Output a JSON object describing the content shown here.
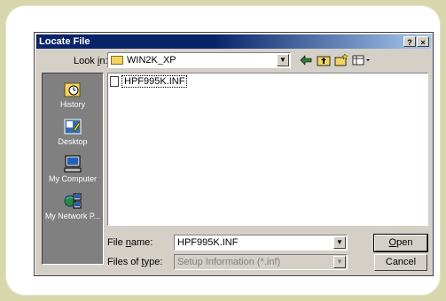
{
  "dialog": {
    "title": "Locate File",
    "help_button": "?",
    "close_button": "×"
  },
  "lookin": {
    "label_pre": "Look ",
    "label_accel": "i",
    "label_post": "n:",
    "value": "WIN2K_XP"
  },
  "toolbar": {
    "back_icon": "back-arrow-icon",
    "up_icon": "up-folder-icon",
    "new_folder_icon": "new-folder-icon",
    "view_icon": "view-menu-icon"
  },
  "places": [
    {
      "label": "History",
      "icon": "history-icon"
    },
    {
      "label": "Desktop",
      "icon": "desktop-icon"
    },
    {
      "label": "My Computer",
      "icon": "my-computer-icon"
    },
    {
      "label": "My Network P...",
      "icon": "network-places-icon"
    }
  ],
  "files": [
    {
      "name": "HPF995K.INF"
    }
  ],
  "filename": {
    "label_pre": "File ",
    "label_accel": "n",
    "label_post": "ame:",
    "value": "HPF995K.INF"
  },
  "filetype": {
    "label_pre": "Files of ",
    "label_accel": "t",
    "label_post": "ype:",
    "value": "Setup Information (*.inf)"
  },
  "buttons": {
    "open_accel": "O",
    "open_rest": "pen",
    "cancel": "Cancel"
  },
  "colors": {
    "title_start": "#0a246a",
    "title_end": "#a6caf0",
    "dialog_face": "#d4d0c8",
    "places_bar": "#808080",
    "page_bg": "#d7d6ad"
  }
}
